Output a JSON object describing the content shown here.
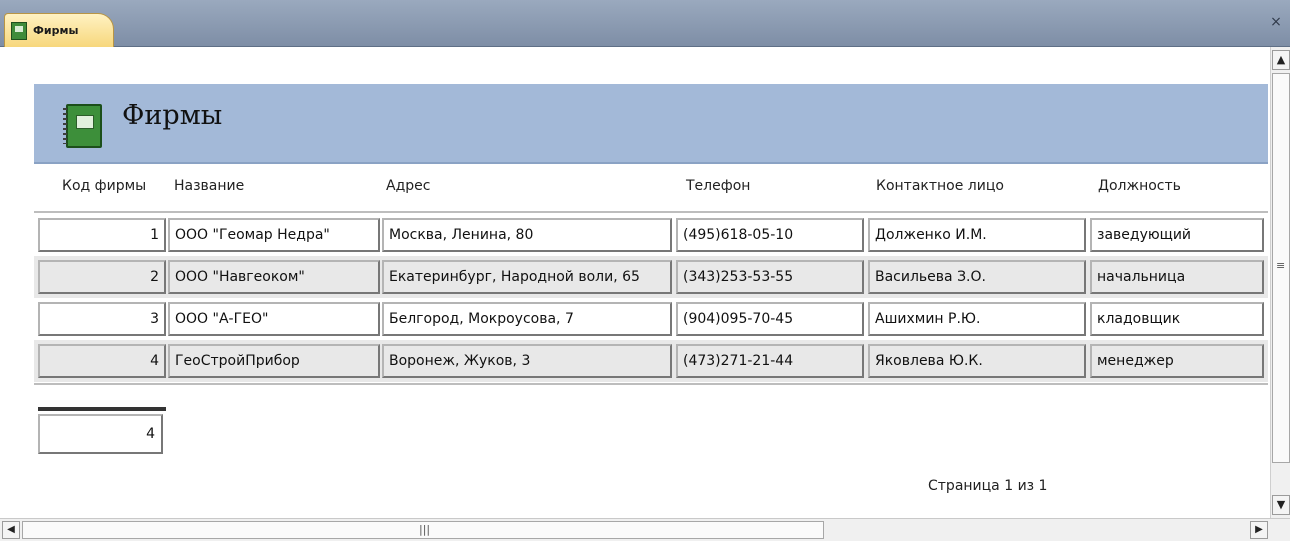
{
  "tab": {
    "label": "Фирмы",
    "close": "×"
  },
  "report": {
    "title": "Фирмы"
  },
  "columns": [
    "Код фирмы",
    "Название",
    "Адрес",
    "Телефон",
    "Контактное лицо",
    "Должность"
  ],
  "rows": [
    [
      "1",
      "ООО \"Геомар Недра\"",
      "Москва, Ленина, 80",
      "(495)618-05-10",
      "Долженко И.М.",
      "заведующий"
    ],
    [
      "2",
      "ООО \"Навгеоком\"",
      "Екатеринбург, Народной воли, 65",
      "(343)253-53-55",
      "Васильева З.О.",
      "начальница"
    ],
    [
      "3",
      "ООО \"А-ГЕО\"",
      "Белгород, Мокроусова, 7",
      "(904)095-70-45",
      "Ашихмин Р.Ю.",
      "кладовщик"
    ],
    [
      "4",
      "ГеоСтройПрибор",
      "Воронеж, Жуков, 3",
      "(473)271-21-44",
      "Яковлева Ю.К.",
      "менеджер"
    ]
  ],
  "total_count": "4",
  "footer": {
    "page_info": "Страница 1 из 1"
  },
  "icons": {
    "tab": "form-icon",
    "header": "notebook-icon"
  },
  "colors": {
    "header_band": "#a3b9d8",
    "tab": "#f7d77c",
    "tabbar": "#8797ae"
  }
}
